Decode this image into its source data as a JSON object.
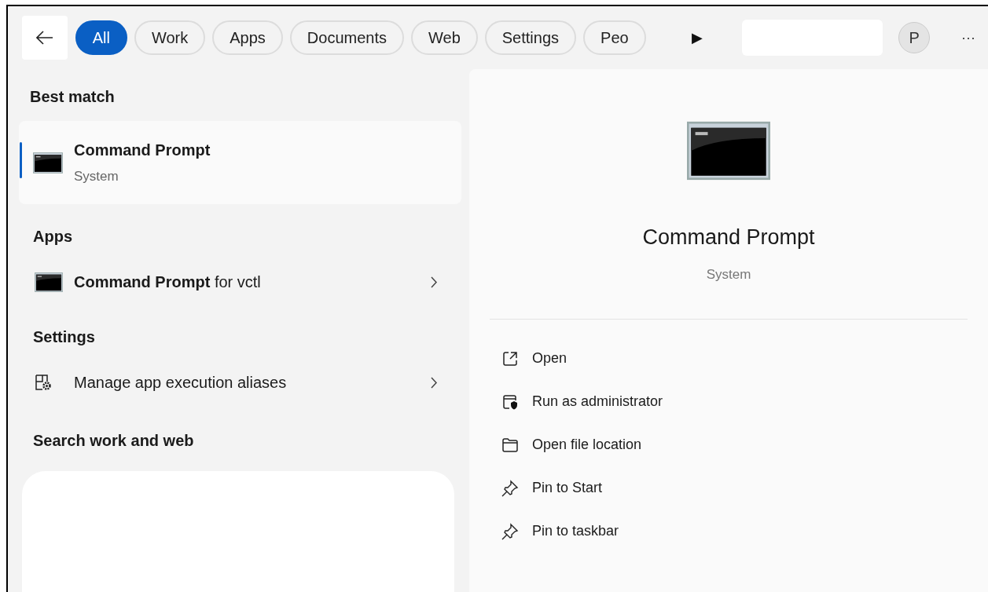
{
  "filters": [
    {
      "label": "All",
      "selected": true
    },
    {
      "label": "Work",
      "selected": false
    },
    {
      "label": "Apps",
      "selected": false
    },
    {
      "label": "Documents",
      "selected": false
    },
    {
      "label": "Web",
      "selected": false
    },
    {
      "label": "Settings",
      "selected": false
    },
    {
      "label": "Peo",
      "selected": false
    }
  ],
  "more_filters": "▶",
  "profile": "P",
  "more_menu": "···",
  "best_match": {
    "header": "Best match",
    "title": "Command Prompt",
    "subtitle": "System",
    "selected": true
  },
  "sections": [
    {
      "header": "Apps",
      "items": [
        {
          "kind": "console",
          "text": "**Command Prompt** for vctl"
        }
      ]
    },
    {
      "header": "Settings",
      "items": [
        {
          "kind": "settings",
          "text": "Manage app execution aliases"
        }
      ]
    }
  ],
  "search_web": {
    "header": "Search work and web"
  },
  "preview": {
    "title": "Command Prompt",
    "subtitle": "System",
    "actions": [
      {
        "kind": "open",
        "label": "Open"
      },
      {
        "kind": "admin",
        "label": "Run as administrator"
      },
      {
        "kind": "folder",
        "label": "Open file location"
      },
      {
        "kind": "pin",
        "label": "Pin to Start"
      },
      {
        "kind": "pin",
        "label": "Pin to taskbar"
      }
    ]
  }
}
